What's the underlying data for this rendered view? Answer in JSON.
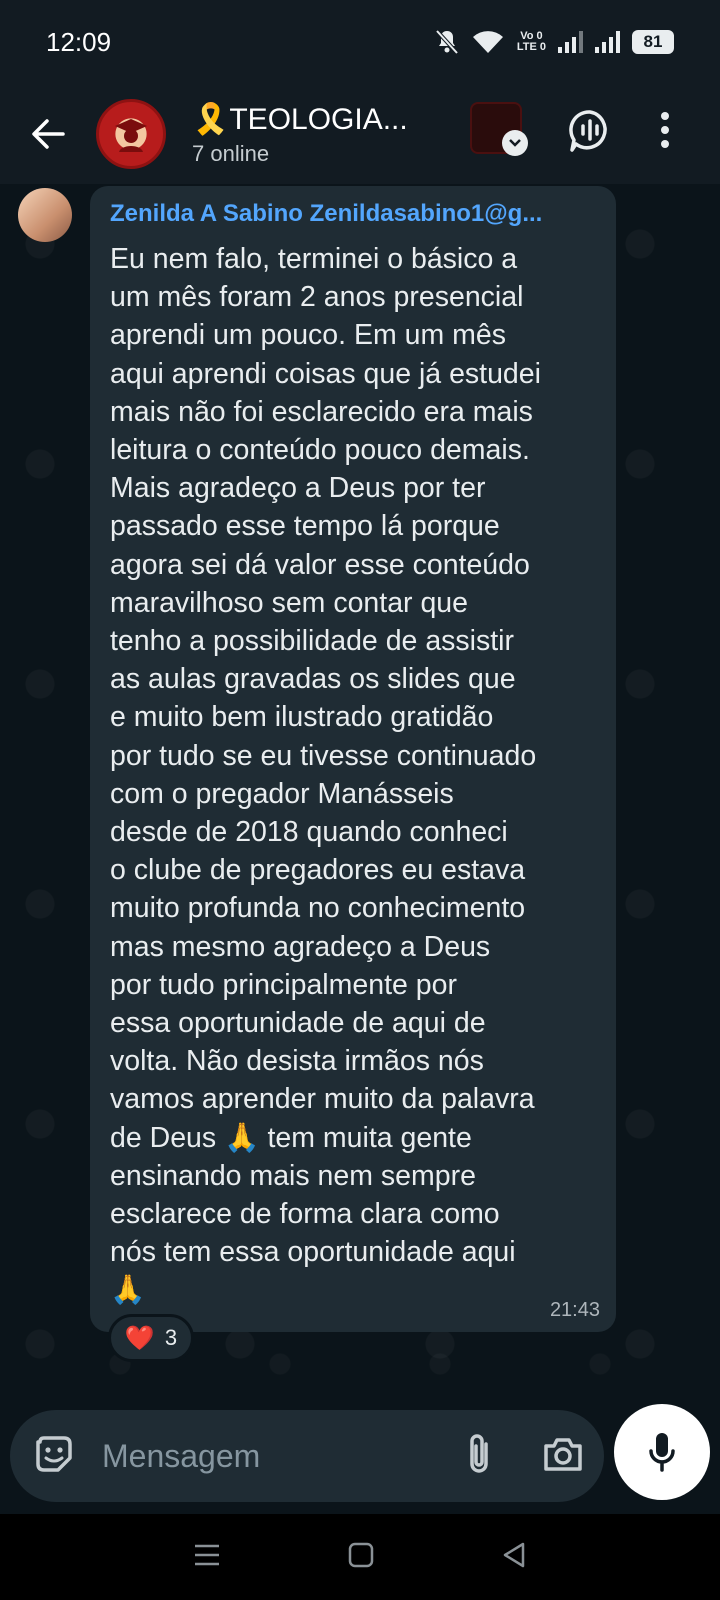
{
  "status_bar": {
    "time": "12:09",
    "network_top": "Vo 0",
    "network_bottom": "LTE 0",
    "battery": "81"
  },
  "header": {
    "title": "🎗️TEOLOGIA...",
    "subtitle": "7 online",
    "icons": [
      "back-arrow",
      "group-avatar",
      "video-thumbnail",
      "voice-chat",
      "more-vert"
    ]
  },
  "message": {
    "sender": "Zenilda A Sabino Zenildasabino1@g...",
    "text": "Eu nem falo, terminei o básico a\num mês foram 2 anos presencial\naprendi um pouco. Em um mês\naqui aprendi coisas que já estudei\nmais não foi esclarecido era mais\nleitura o conteúdo pouco demais.\nMais agradeço a Deus por ter\npassado esse tempo lá porque\nagora sei dá valor esse conteúdo\nmaravilhoso sem contar que\ntenho a possibilidade de assistir\nas aulas gravadas os slides que\ne muito bem ilustrado gratidão\npor tudo se eu tivesse continuado\ncom o pregador Manásseis\ndesde de 2018 quando conheci\no clube de pregadores eu estava\nmuito profunda no conhecimento\nmas mesmo agradeço a Deus\npor tudo principalmente por\nessa oportunidade de aqui de\nvolta. Não desista irmãos nós\nvamos aprender muito da palavra\nde Deus 🙏 tem muita gente\nensinando mais nem sempre\nesclarece de forma clara como\nnós tem essa oportunidade aqui\n🙏",
    "time": "21:43",
    "reaction_emoji": "❤️",
    "reaction_count": "3"
  },
  "composer": {
    "placeholder": "Mensagem"
  },
  "colors": {
    "background": "#0b141a",
    "bubble": "#1f2c34",
    "sender_name": "#53a6fd",
    "header": "#121b22"
  }
}
